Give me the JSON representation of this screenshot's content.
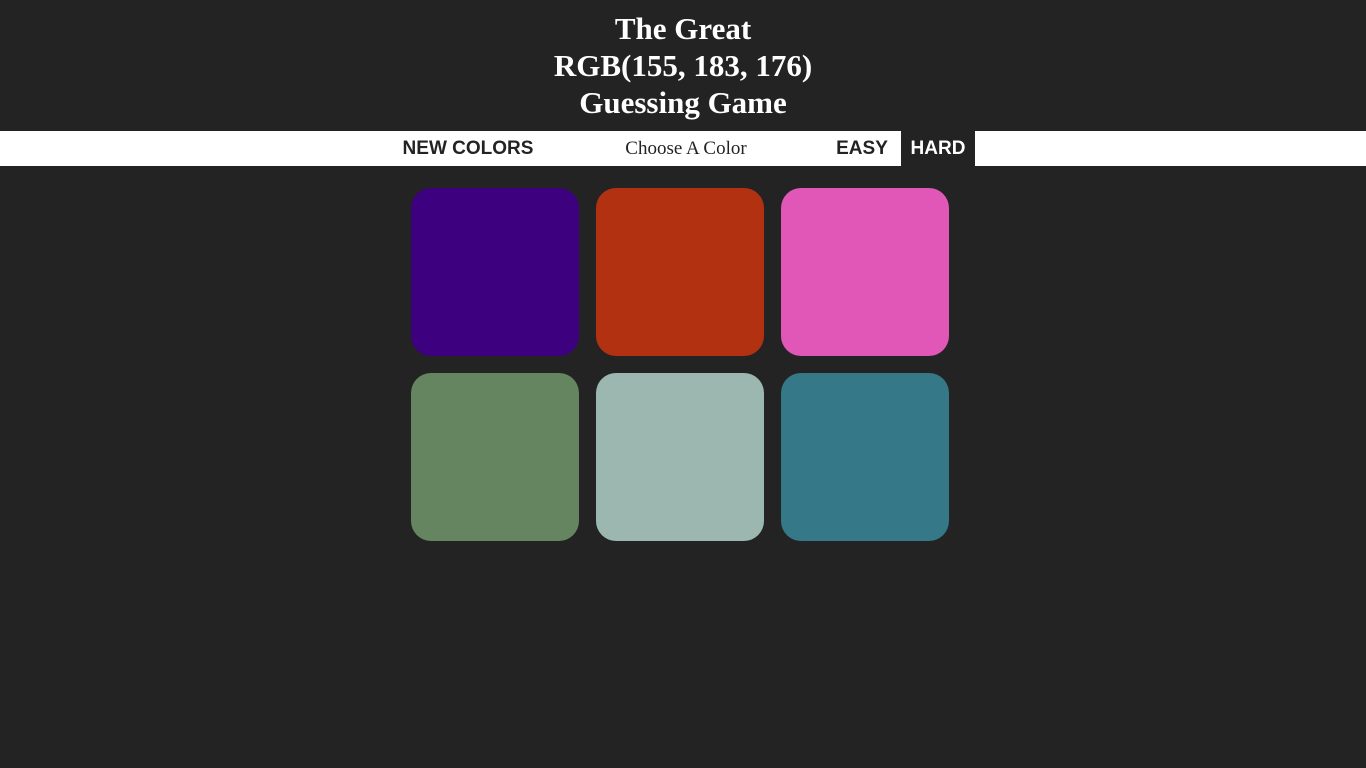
{
  "header": {
    "line1": "The Great",
    "color_display": "RGB(155, 183, 176)",
    "line3": "Guessing Game"
  },
  "controls": {
    "reset_label": "NEW COLORS",
    "message": "Choose A Color",
    "easy_label": "EASY",
    "hard_label": "HARD",
    "selected_mode": "HARD"
  },
  "theme": {
    "background": "#232323",
    "stripe": "#ffffff",
    "text_dark": "#232323",
    "text_light": "#ffffff"
  },
  "squares": [
    {
      "color": "#3d0180"
    },
    {
      "color": "#b23110"
    },
    {
      "color": "#e057b8"
    },
    {
      "color": "#658460"
    },
    {
      "color": "#9bb7b0"
    },
    {
      "color": "#357888"
    }
  ]
}
